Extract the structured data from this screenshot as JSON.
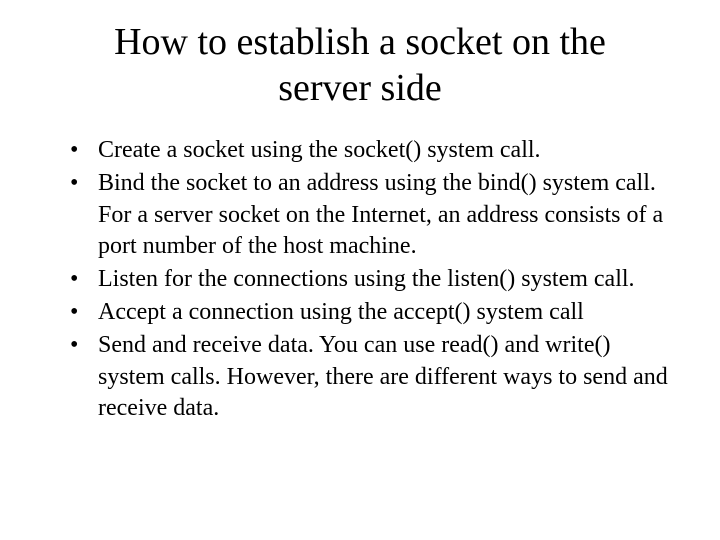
{
  "title": "How to establish a socket on the server side",
  "bullets": {
    "b0": "Create a socket using the socket() system call.",
    "b1": "Bind the socket to an address using the bind() system call. For a server socket on the Internet, an address consists of a port number of the host machine.",
    "b2": "Listen for the connections using the listen() system call.",
    "b3": "Accept a connection using the accept() system call",
    "b4": "Send and receive data. You can use read() and write() system calls. However, there are different ways to send and receive data."
  }
}
